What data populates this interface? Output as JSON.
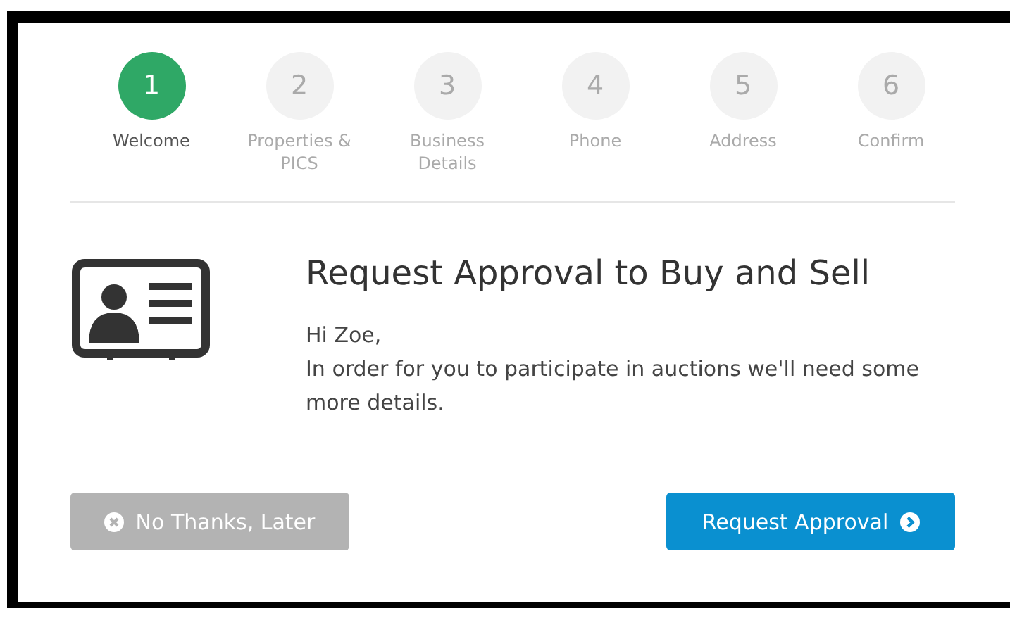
{
  "steps": [
    {
      "number": "1",
      "label": "Welcome",
      "selected": true
    },
    {
      "number": "2",
      "label": "Properties & PICS",
      "selected": false
    },
    {
      "number": "3",
      "label": "Business Details",
      "selected": false
    },
    {
      "number": "4",
      "label": "Phone",
      "selected": false
    },
    {
      "number": "5",
      "label": "Address",
      "selected": false
    },
    {
      "number": "6",
      "label": "Confirm",
      "selected": false
    }
  ],
  "title": "Request Approval to Buy and Sell",
  "greeting": "Hi Zoe,",
  "message": "In order for you to participate in auctions we'll need some more details.",
  "buttons": [
    {
      "kind": "secondary",
      "label": "No Thanks, Later"
    },
    {
      "kind": "primary",
      "label": "Request Approval"
    }
  ]
}
